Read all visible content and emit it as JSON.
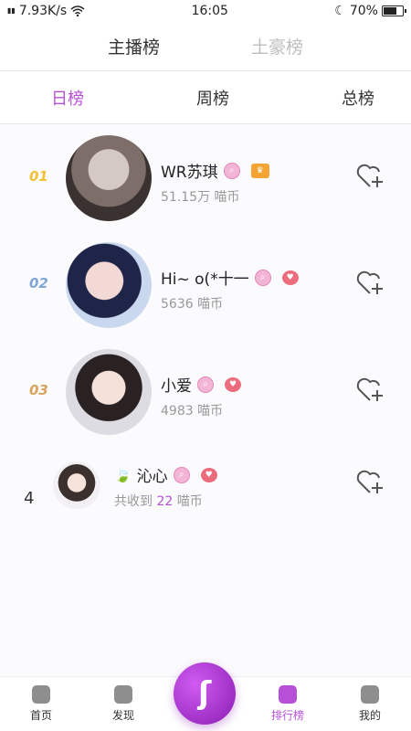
{
  "status": {
    "speed": "7.93K/s",
    "time": "16:05",
    "battery": "70%"
  },
  "top_tabs": [
    "主播榜",
    "土豪榜"
  ],
  "period_tabs": [
    "日榜",
    "周榜",
    "总榜"
  ],
  "ranks": [
    {
      "rank": "01",
      "name": "WR苏琪",
      "coins": "51.15万 喵币"
    },
    {
      "rank": "02",
      "name": "Hi~ o(*十一",
      "coins": "5636 喵币"
    },
    {
      "rank": "03",
      "name": "小爱",
      "coins": "4983 喵币"
    },
    {
      "rank": "4",
      "name": "沁心",
      "coins_prefix": "共收到",
      "coins_value": "22",
      "coins_unit": "喵币"
    }
  ],
  "nav": [
    "首页",
    "发现",
    "排行榜",
    "我的"
  ]
}
